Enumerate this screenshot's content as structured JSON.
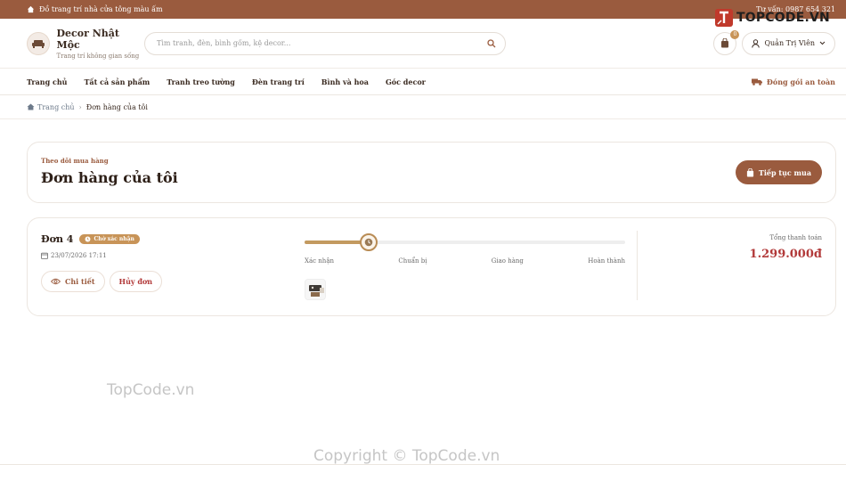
{
  "topbar": {
    "promo": "Đồ trang trí nhà cửa tông màu ấm",
    "hotline": "Tư vấn: 0987 654 321"
  },
  "brand": {
    "name": "Decor Nhật Mộc",
    "tagline": "Trang trí không gian sống"
  },
  "search": {
    "placeholder": "Tìm tranh, đèn, bình gốm, kệ decor..."
  },
  "cart": {
    "count": "0"
  },
  "user": {
    "name": "Quản Trị Viên"
  },
  "nav": {
    "items": [
      {
        "label": "Trang chủ"
      },
      {
        "label": "Tất cả sản phẩm"
      },
      {
        "label": "Tranh treo tường"
      },
      {
        "label": "Đèn trang trí"
      },
      {
        "label": "Bình và hoa"
      },
      {
        "label": "Góc decor"
      }
    ],
    "shipping_note": "Đóng gói an toàn"
  },
  "breadcrumb": {
    "home": "Trang chủ",
    "current": "Đơn hàng của tôi"
  },
  "page": {
    "eyebrow": "Theo dõi mua hàng",
    "title": "Đơn hàng của tôi",
    "continue_label": "Tiếp tục mua"
  },
  "orders": [
    {
      "id_label": "Đơn 4",
      "status": "Chờ xác nhận",
      "date": "23/07/2026 17:11",
      "detail_label": "Chi tiết",
      "cancel_label": "Hủy đơn",
      "progress_fraction": 0.2,
      "steps": [
        "Xác nhận",
        "Chuẩn bị",
        "Giao hàng",
        "Hoàn thành"
      ],
      "total_label": "Tổng thanh toán",
      "total_value": "1.299.000đ"
    }
  ],
  "watermarks": {
    "logo": "TOPCODE.VN",
    "mid": "TopCode.vn",
    "bottom": "Copyright © TopCode.vn"
  },
  "colors": {
    "brand": "#9a5b3e",
    "accent": "#c89458",
    "price": "#b23a3a"
  }
}
